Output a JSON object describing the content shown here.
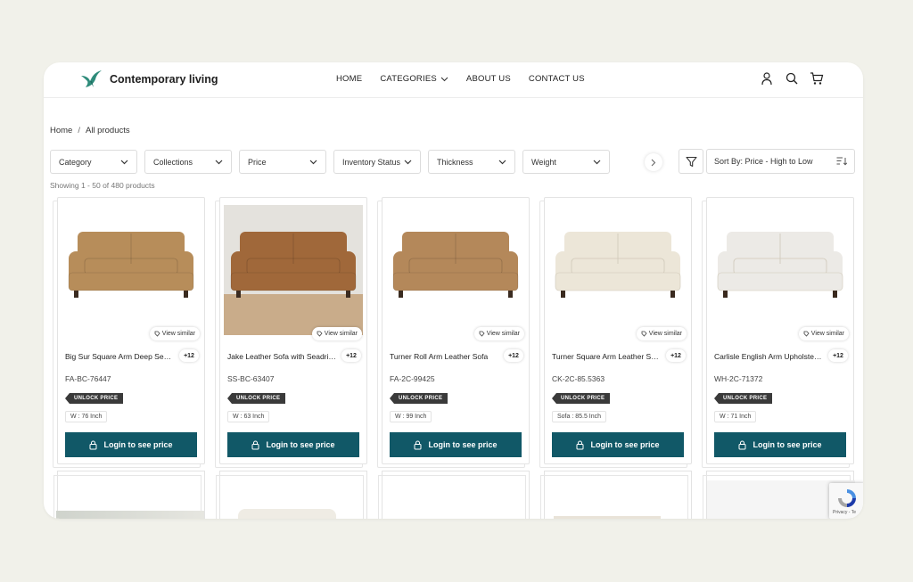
{
  "header": {
    "brand": "Contemporary living",
    "nav": [
      {
        "label": "HOME"
      },
      {
        "label": "CATEGORIES",
        "has_dropdown": true
      },
      {
        "label": "ABOUT US"
      },
      {
        "label": "CONTACT US"
      }
    ],
    "icons": [
      "user-icon",
      "search-icon",
      "cart-icon"
    ]
  },
  "breadcrumb": {
    "home": "Home",
    "separator": "/",
    "current": "All products"
  },
  "filters": [
    "Category",
    "Collections",
    "Price",
    "Inventory Status",
    "Thickness",
    "Weight"
  ],
  "sort": {
    "label": "Sort By: Price - High to Low"
  },
  "results": {
    "text": "Showing 1 - 50 of 480 products"
  },
  "product_labels": {
    "view_similar": "View similar",
    "unlock_price": "UNLOCK PRICE",
    "login": "Login to see price"
  },
  "products": [
    {
      "name": "Big Sur Square Arm Deep Seat Sofa",
      "variants": "+12",
      "sku": "FA-BC-76447",
      "dimension": "W : 76 Inch",
      "color": "#b78d5a",
      "style": "deep"
    },
    {
      "name": "Jake Leather Sofa with Seadrift Legs",
      "variants": "+12",
      "sku": "SS-BC-63407",
      "dimension": "W : 63 Inch",
      "color": "#a0683a",
      "style": "room"
    },
    {
      "name": "Turner Roll Arm Leather Sofa",
      "variants": "+12",
      "sku": "FA-2C-99425",
      "dimension": "W : 99 Inch",
      "color": "#b4885a",
      "style": "roll"
    },
    {
      "name": "Turner Square Arm Leather Sofa",
      "variants": "+12",
      "sku": "CK-2C-85.5363",
      "dimension": "Sofa : 85.5 Inch",
      "color": "#ece6d8",
      "style": "square"
    },
    {
      "name": "Carlisle English Arm Upholstered Sofa",
      "variants": "+12",
      "sku": "WH-2C-71372",
      "dimension": "W : 71 Inch",
      "color": "#eceae6",
      "style": "english"
    }
  ],
  "colors": {
    "accent": "#115867",
    "badge": "#3a3a3a",
    "background": "#f1f1ea"
  },
  "recaptcha": {
    "text": "Privacy - Te"
  }
}
